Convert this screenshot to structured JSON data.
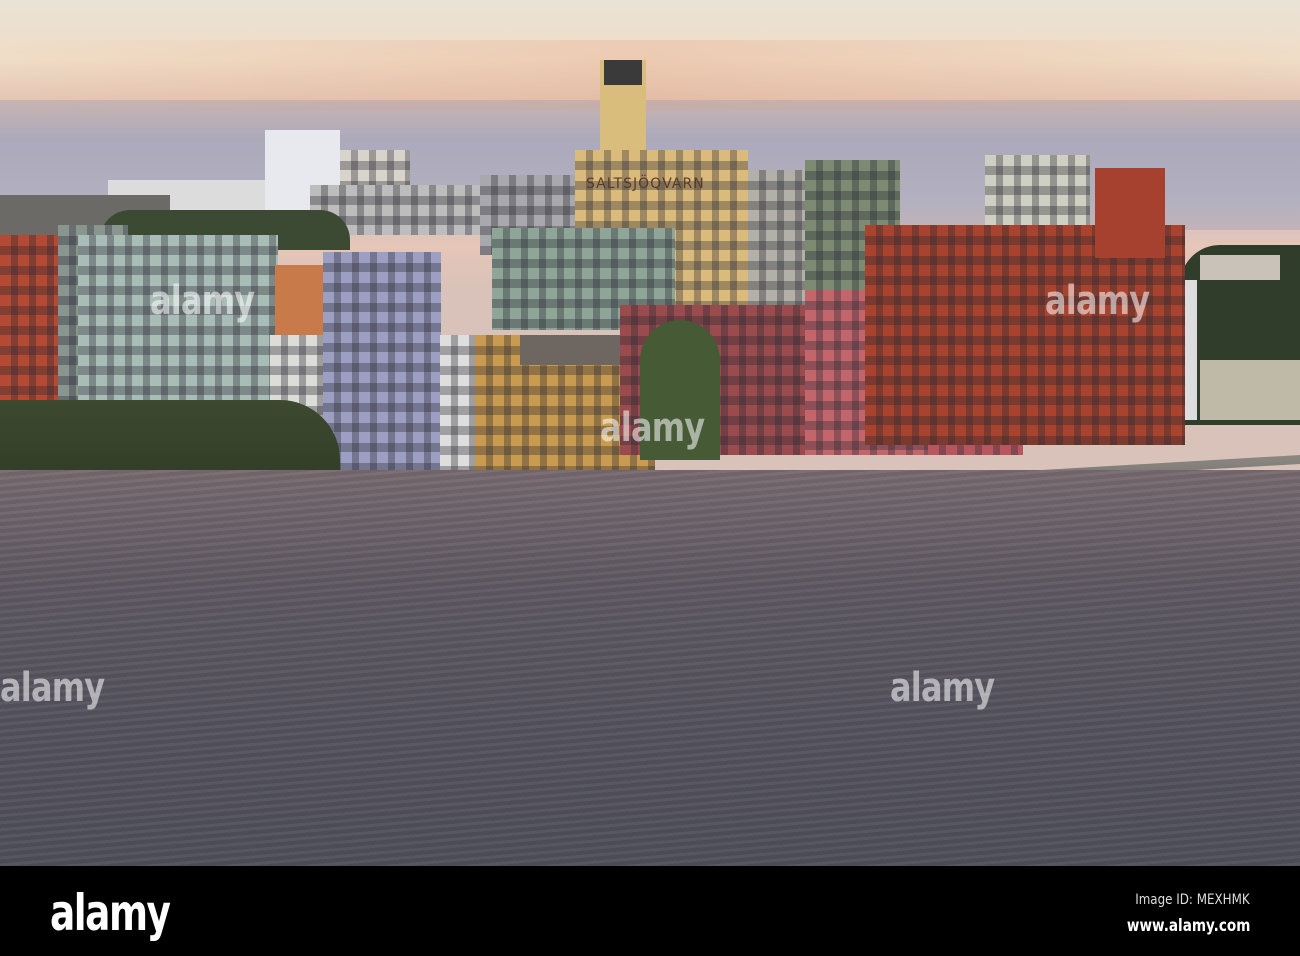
{
  "photo": {
    "building_sign": "SALTSJÖQVARN"
  },
  "watermark": {
    "text": "alamy"
  },
  "footer": {
    "logo": "alamy",
    "image_id": "Image ID: MEXHMK",
    "website": "www.alamy.com"
  }
}
